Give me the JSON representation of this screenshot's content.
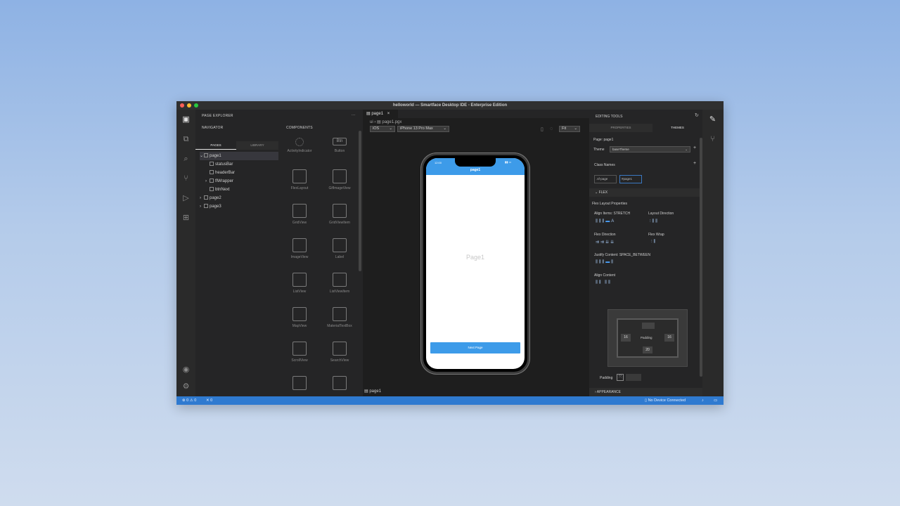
{
  "window": {
    "title": "helloworld — Smartface Desktop IDE - Enterprise Edition"
  },
  "explorer": {
    "title": "PAGE EXPLORER",
    "more": "···",
    "navigator": "NAVIGATOR",
    "tabs": [
      "PAGES",
      "LIBRARY"
    ],
    "tree": [
      {
        "label": "page1",
        "level": 0,
        "arrow": "⌄"
      },
      {
        "label": "statusBar",
        "level": 1,
        "arrow": ""
      },
      {
        "label": "headerBar",
        "level": 1,
        "arrow": ""
      },
      {
        "label": "flWrapper",
        "level": 1,
        "arrow": "›"
      },
      {
        "label": "btnNext",
        "level": 1,
        "arrow": ""
      },
      {
        "label": "page2",
        "level": 0,
        "arrow": "›"
      },
      {
        "label": "page3",
        "level": 0,
        "arrow": "›"
      }
    ],
    "components_title": "COMPONENTS",
    "components": [
      {
        "label": "ActivityIndicator",
        "icon": "activity-indicator-icon"
      },
      {
        "label": "Button",
        "icon": "button-icon",
        "glyph": "Btn"
      },
      {
        "label": "FlexLayout",
        "icon": "flexlayout-icon"
      },
      {
        "label": "GifImageView",
        "icon": "gifimageview-icon"
      },
      {
        "label": "GridView",
        "icon": "gridview-icon"
      },
      {
        "label": "GridViewItem",
        "icon": "gridviewitem-icon"
      },
      {
        "label": "ImageView",
        "icon": "imageview-icon"
      },
      {
        "label": "Label",
        "icon": "label-icon"
      },
      {
        "label": "ListView",
        "icon": "listview-icon"
      },
      {
        "label": "ListViewItem",
        "icon": "listviewitem-icon"
      },
      {
        "label": "MapView",
        "icon": "mapview-icon"
      },
      {
        "label": "MaterialTextBox",
        "icon": "materialtextbox-icon"
      },
      {
        "label": "ScrollView",
        "icon": "scrollview-icon"
      },
      {
        "label": "SearchView",
        "icon": "searchview-icon"
      },
      {
        "label": "",
        "icon": "layout-icon"
      },
      {
        "label": "",
        "icon": "slider-icon"
      }
    ]
  },
  "editor": {
    "tab": "page1",
    "breadcrumb": [
      "ui",
      "page1.pgx"
    ],
    "os": "iOS",
    "device": "iPhone 13 Pro Max",
    "zoom": "Fit",
    "footer": "page1"
  },
  "phone": {
    "time": "12:00",
    "header": "page1",
    "center": "Page1",
    "button": "Next Page",
    "accent": "#3d9be9"
  },
  "props": {
    "title": "EDITING TOOLS",
    "tabs": [
      "PROPERTIES",
      "THEMES"
    ],
    "page": "Page: page1",
    "theme_label": "Theme",
    "theme_value": "baseTheme",
    "class_names": "Class Names",
    "classes": [
      ".sf-page",
      "#page1"
    ],
    "flex_section": "FLEX",
    "flex_layout": "Flex Layout Properties",
    "align_items": "Align Items: STRETCH",
    "layout_direction": "Layout Direction",
    "flex_direction": "Flex Direction",
    "flex_wrap": "Flex Wrap",
    "justify": "Justify Content: SPACE_BETWEEN",
    "align_content": "Align Content",
    "pad_left": "16",
    "pad_right": "16",
    "pad_bottom": "20",
    "padding_center": "Padding",
    "padding_label": "Padding",
    "appearance": "APPEARANCE"
  },
  "status": {
    "errors": "0",
    "warnings": "0",
    "extra": "0",
    "device": "No Device Connected"
  }
}
